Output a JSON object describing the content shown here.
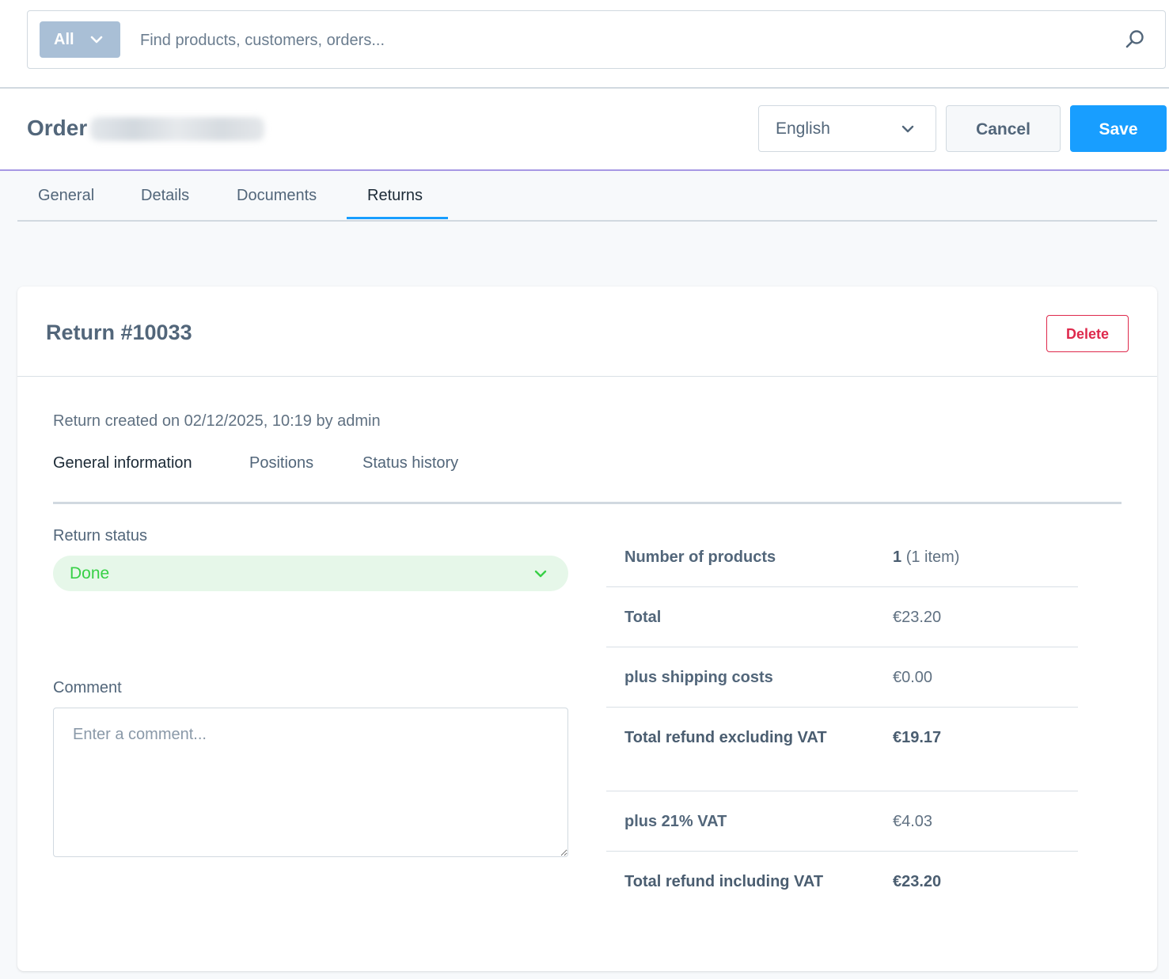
{
  "search": {
    "type_label": "All",
    "placeholder": "Find products, customers, orders..."
  },
  "header": {
    "title": "Order",
    "order_number": "",
    "language": "English",
    "cancel_label": "Cancel",
    "save_label": "Save"
  },
  "tabs": [
    {
      "label": "General"
    },
    {
      "label": "Details"
    },
    {
      "label": "Documents"
    },
    {
      "label": "Returns",
      "active": true
    }
  ],
  "return": {
    "title": "Return #10033",
    "delete_label": "Delete",
    "created_info": "Return created on 02/12/2025, 10:19 by admin",
    "subtabs": [
      {
        "label": "General information",
        "active": true
      },
      {
        "label": "Positions"
      },
      {
        "label": "Status history"
      }
    ],
    "status_label": "Return status",
    "status_value": "Done",
    "comment_label": "Comment",
    "comment_placeholder": "Enter a comment..."
  },
  "summary": {
    "number_of_products_label": "Number of products",
    "number_of_products_count": "1",
    "number_of_products_items": "(1 item)",
    "total_label": "Total",
    "total_value": "€23.20",
    "shipping_label": "plus shipping costs",
    "shipping_value": "€0.00",
    "refund_excl_label": "Total refund excluding VAT",
    "refund_excl_value": "€19.17",
    "vat_label": "plus 21% VAT",
    "vat_value": "€4.03",
    "refund_incl_label": "Total refund including VAT",
    "refund_incl_value": "€23.20"
  },
  "colors": {
    "primary": "#189eff",
    "danger": "#de294c",
    "success": "#37d046",
    "header_accent": "#a798e4"
  }
}
